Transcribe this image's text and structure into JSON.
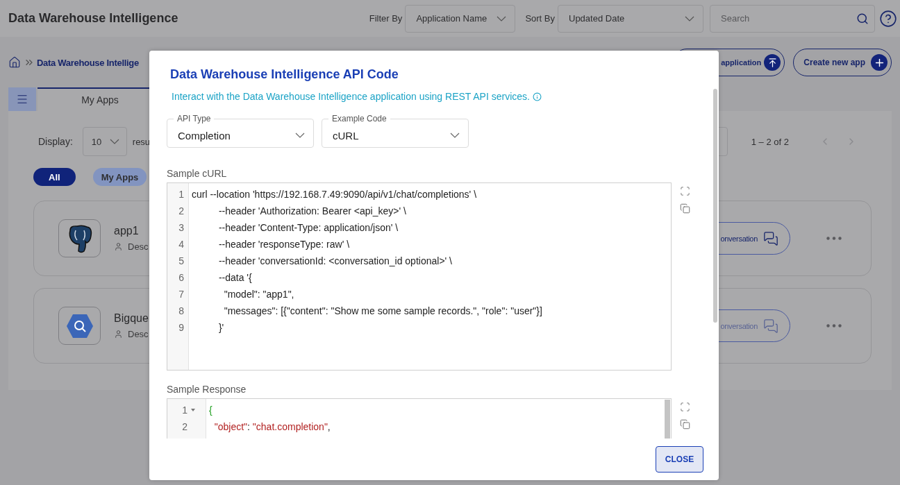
{
  "header": {
    "title": "Data Warehouse Intelligence",
    "filter_label": "Filter By",
    "filter_value": "Application Name",
    "sort_label": "Sort By",
    "sort_value": "Updated Date",
    "search": {
      "placeholder": "Search"
    }
  },
  "breadcrumb": {
    "current": "Data Warehouse Intellige"
  },
  "actions": [
    {
      "label": "application",
      "kind": "upload"
    },
    {
      "label": "Create new app",
      "kind": "create"
    }
  ],
  "tabs": [
    {
      "label": "My Apps",
      "selected": true
    }
  ],
  "display": {
    "label": "Display:",
    "value": "10",
    "suffix": "resu"
  },
  "pagination": {
    "range": "1 – 2 of 2"
  },
  "chips": [
    {
      "label": "All",
      "selected": true
    },
    {
      "label": "My Apps",
      "selected": false
    }
  ],
  "apps": [
    {
      "name": "app1",
      "description": "Desc",
      "kind": "postgres",
      "action": "onversation",
      "disabled": false
    },
    {
      "name": "Bigque",
      "description": "Desc",
      "kind": "bigquery",
      "action": "onversation",
      "disabled": true
    }
  ],
  "dialog": {
    "title": "Data Warehouse Intelligence API Code",
    "subtitle": "Interact with the Data Warehouse Intelligence application using REST API services.",
    "selects": [
      {
        "label": "API Type",
        "value": "Completion"
      },
      {
        "label": "Example Code",
        "value": "cURL"
      }
    ],
    "sample_curl": {
      "label": "Sample cURL",
      "lines": [
        {
          "number": "1",
          "text": "curl --location 'https://192.168.7.49:9090/api/v1/chat/completions' \\"
        },
        {
          "number": "2",
          "text": "          --header 'Authorization: Bearer <api_key>' \\"
        },
        {
          "number": "3",
          "text": "          --header 'Content-Type: application/json' \\"
        },
        {
          "number": "4",
          "text": "          --header 'responseType: raw' \\"
        },
        {
          "number": "5",
          "text": "          --header 'conversationId: <conversation_id optional>' \\"
        },
        {
          "number": "6",
          "text": "          --data '{"
        },
        {
          "number": "7",
          "text": "            \"model\": \"app1\","
        },
        {
          "number": "8",
          "text": "            \"messages\": [{\"content\": \"Show me some sample records.\", \"role\": \"user\"}]"
        },
        {
          "number": "9",
          "text": "          }'"
        }
      ]
    },
    "sample_response": {
      "label": "Sample Response",
      "lines": [
        {
          "number": "1",
          "foldable": true,
          "tokens": [
            {
              "text": "{",
              "kind": "brace"
            }
          ]
        },
        {
          "number": "2",
          "foldable": false,
          "tokens": [
            {
              "text": "  \"object\"",
              "kind": "key"
            },
            {
              "text": ": ",
              "kind": "punct"
            },
            {
              "text": "\"chat.completion\"",
              "kind": "string"
            },
            {
              "text": ",",
              "kind": "punct"
            }
          ]
        }
      ]
    },
    "close": "CLOSE"
  }
}
